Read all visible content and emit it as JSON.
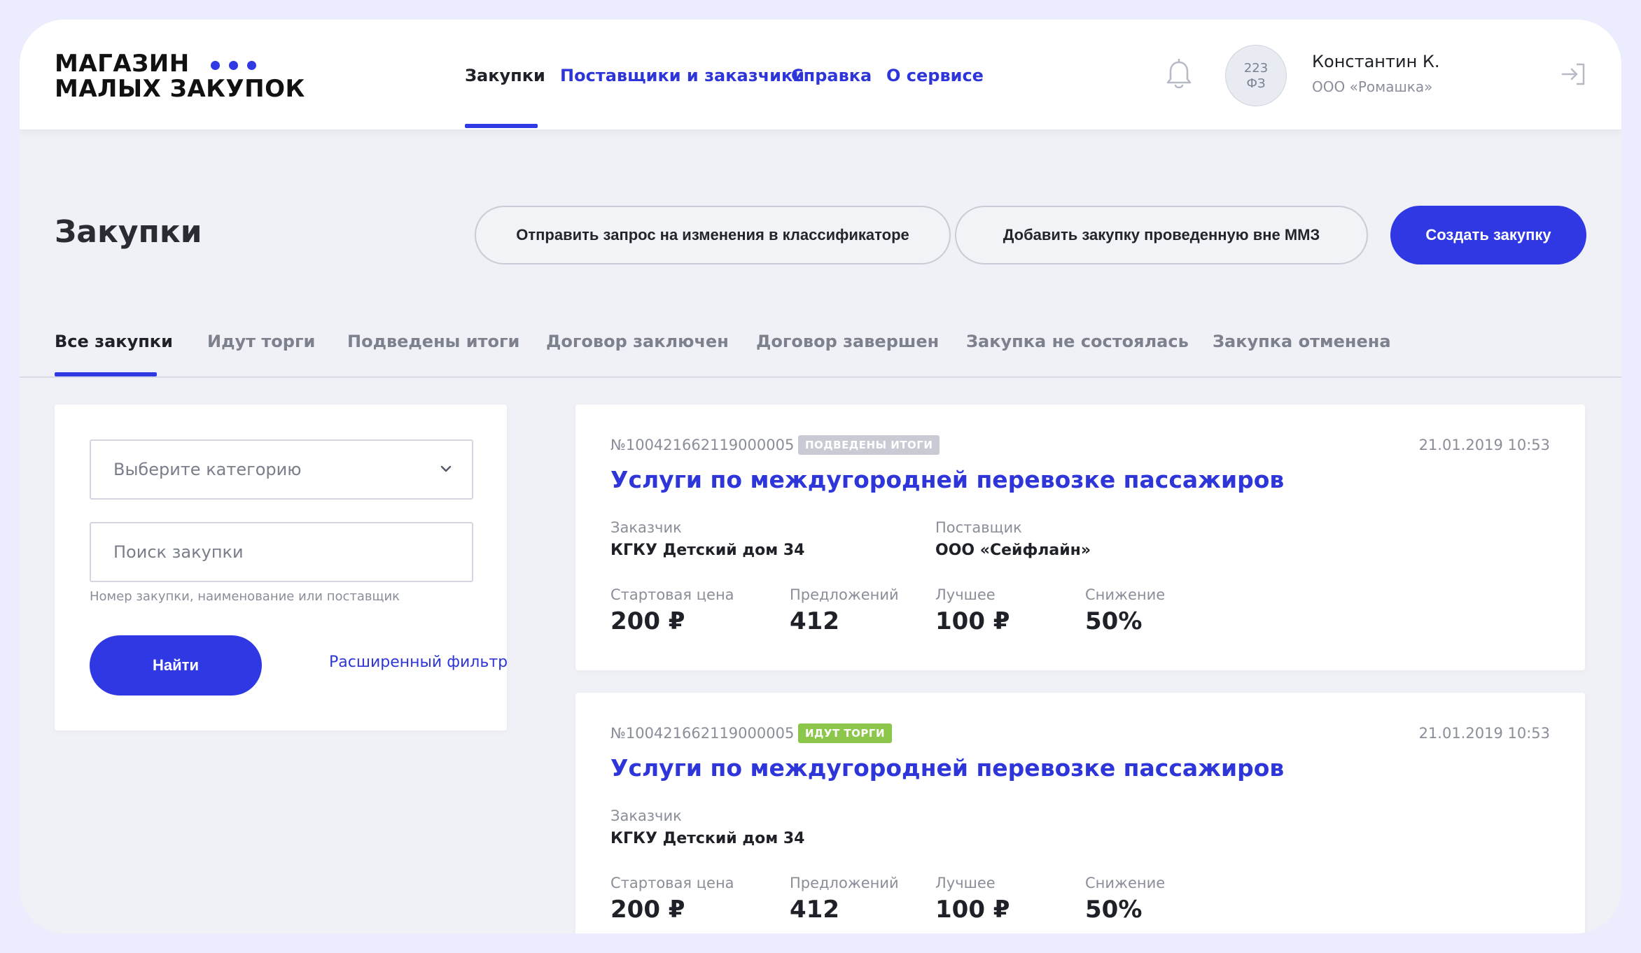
{
  "logo": {
    "line1": "МАГАЗИН",
    "line2": "МАЛЫХ ЗАКУПОК"
  },
  "nav": {
    "items": [
      {
        "label": "Закупки"
      },
      {
        "label": "Поставщики и заказчики"
      },
      {
        "label": "Справка"
      },
      {
        "label": "О сервисе"
      }
    ],
    "active_index": 0
  },
  "user": {
    "avatar_line1": "223",
    "avatar_line2": "ФЗ",
    "name": "Константин К.",
    "org": "ООО «Ромашка»"
  },
  "icons": {
    "bell": "bell-icon",
    "logout": "logout-icon",
    "chevron": "chevron-down-icon"
  },
  "colors": {
    "accent": "#2f38e3",
    "badge_results": "#c8cbd3",
    "badge_trading": "#8cc64b"
  },
  "page": {
    "title": "Закупки",
    "actions": {
      "request_change": "Отправить запрос на изменения в классификаторе",
      "add_external": "Добавить закупку проведенную вне ММЗ",
      "create": "Создать закупку"
    }
  },
  "tabs": [
    {
      "label": "Все закупки"
    },
    {
      "label": "Идут торги"
    },
    {
      "label": "Подведены итоги"
    },
    {
      "label": "Договор заключен"
    },
    {
      "label": "Договор завершен"
    },
    {
      "label": "Закупка не состоялась"
    },
    {
      "label": "Закупка отменена"
    }
  ],
  "filter": {
    "category_placeholder": "Выберите категорию",
    "search_placeholder": "Поиск закупки",
    "search_value": "",
    "hint": "Номер закупки, наименование или поставщик",
    "find_button": "Найти",
    "advanced_link": "Расширенный фильтр"
  },
  "cards": [
    {
      "number": "№100421662119000005",
      "badge": "ПОДВЕДЕНЫ ИТОГИ",
      "date": "21.01.2019 10:53",
      "title": "Услуги по междугородней перевозке пассажиров",
      "customer_label": "Заказчик",
      "customer": "КГКУ Детский дом 34",
      "supplier_label": "Поставщик",
      "supplier": "ООО «Сейфлайн»",
      "start_price_label": "Стартовая цена",
      "start_price": "200 ₽",
      "offers_label": "Предложений",
      "offers": "412",
      "best_label": "Лучшее",
      "best": "100 ₽",
      "decrease_label": "Снижение",
      "decrease": "50%"
    },
    {
      "number": "№100421662119000005",
      "badge": "ИДУТ ТОРГИ",
      "date": "21.01.2019 10:53",
      "title": "Услуги по междугородней перевозке пассажиров",
      "customer_label": "Заказчик",
      "customer": "КГКУ Детский дом 34",
      "start_price_label": "Стартовая цена",
      "start_price": "200 ₽",
      "offers_label": "Предложений",
      "offers": "412",
      "best_label": "Лучшее",
      "best": "100 ₽",
      "decrease_label": "Снижение",
      "decrease": "50%"
    }
  ]
}
